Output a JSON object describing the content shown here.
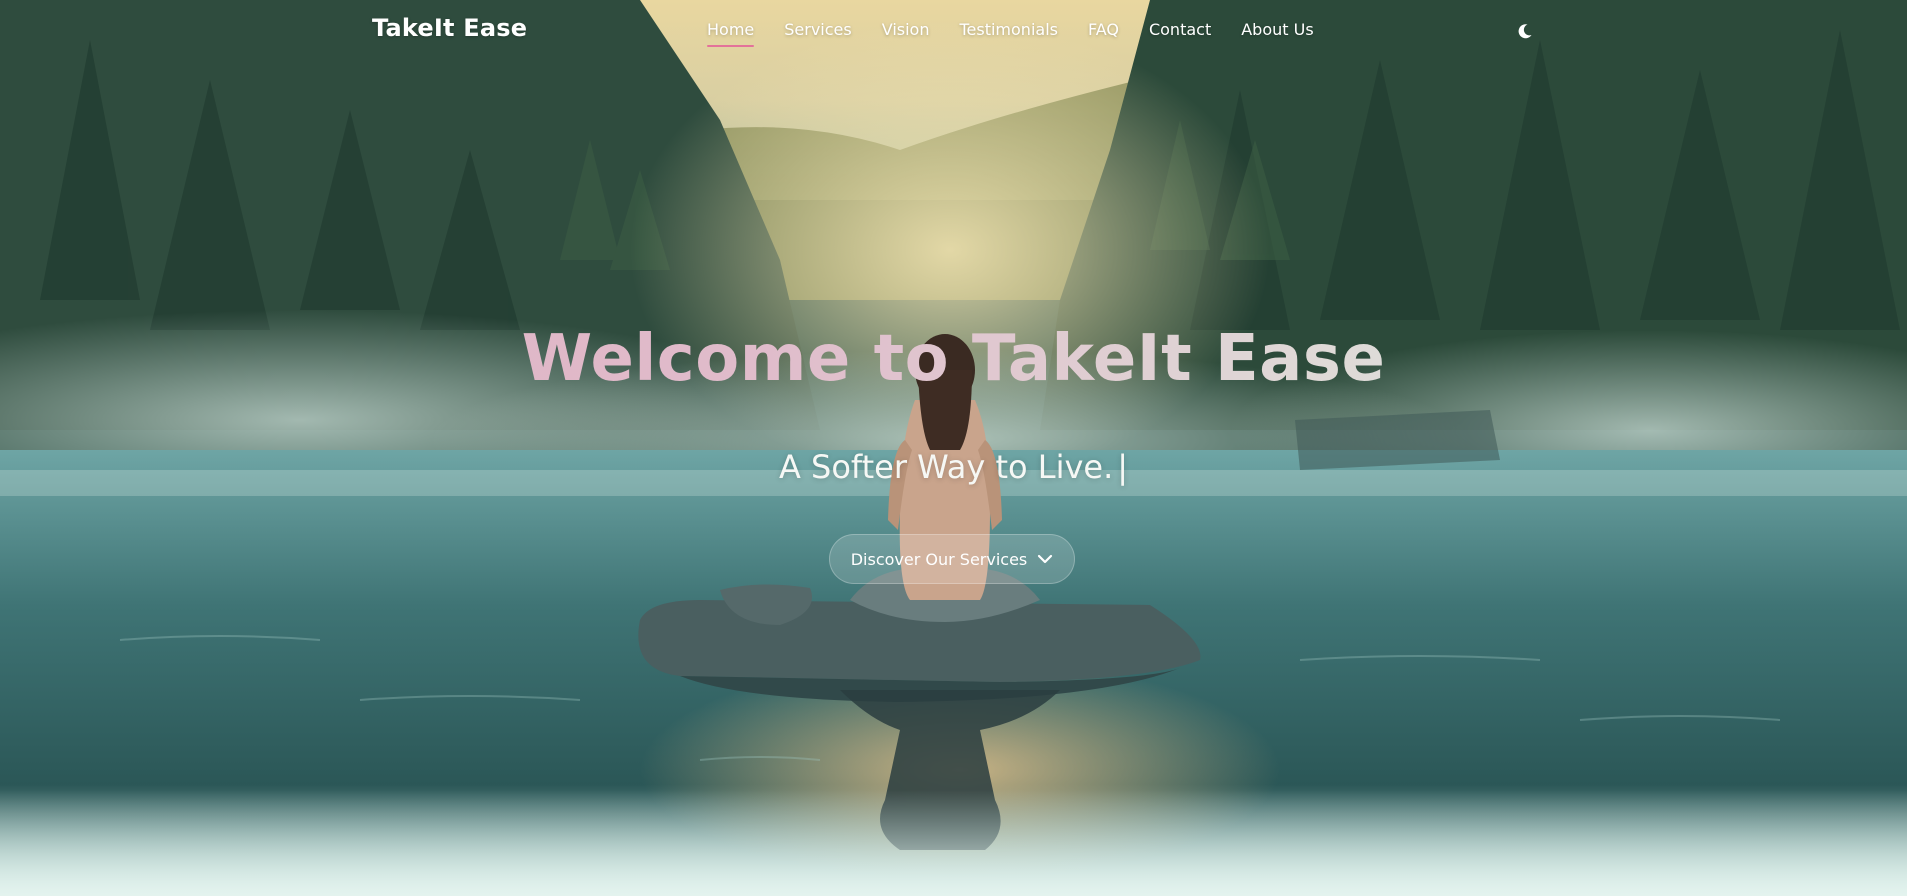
{
  "nav": {
    "logo": "TakeIt Ease",
    "links": [
      {
        "label": "Home",
        "active": true
      },
      {
        "label": "Services",
        "active": false
      },
      {
        "label": "Vision",
        "active": false
      },
      {
        "label": "Testimonials",
        "active": false
      },
      {
        "label": "FAQ",
        "active": false
      },
      {
        "label": "Contact",
        "active": false
      },
      {
        "label": "About Us",
        "active": false
      }
    ],
    "theme_toggle_icon": "moon-icon"
  },
  "hero": {
    "headline": "Welcome to TakeIt Ease",
    "subtitle": "A Softer Way to Live.",
    "cursor": "|",
    "cta_label": "Discover Our Services",
    "cta_icon": "chevron-down-icon",
    "background_image": "woman-meditating-on-rock-in-misty-forest-lake"
  },
  "colors": {
    "accent": "#e3729a",
    "headline_start": "#deaec0",
    "headline_end": "#d5e6df",
    "text": "#ffffff"
  }
}
